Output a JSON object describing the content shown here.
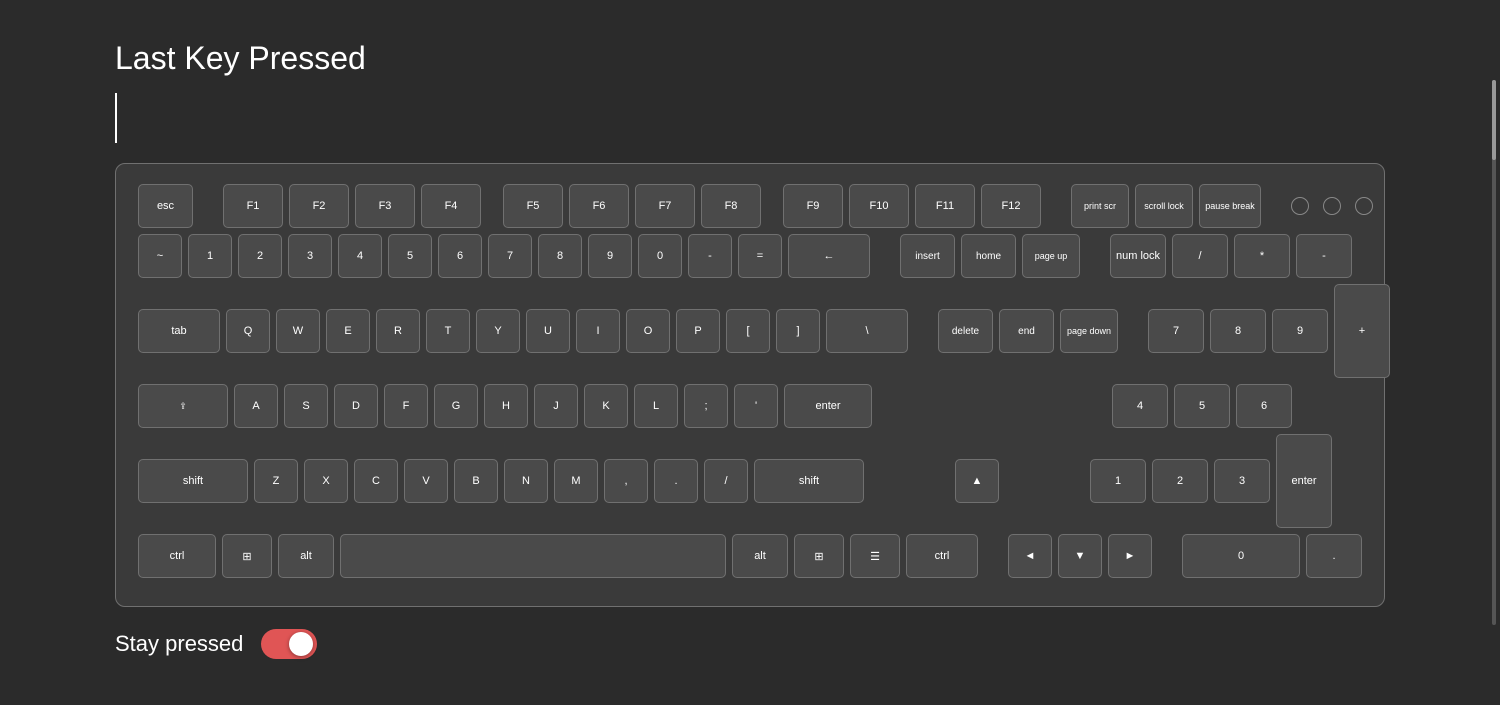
{
  "page": {
    "title": "Last Key Pressed",
    "background": "#2b2b2b"
  },
  "bottom": {
    "stay_pressed_label": "Stay pressed",
    "toggle_state": true
  },
  "keyboard": {
    "rows": {
      "fn": {
        "esc": "esc",
        "f1": "F1",
        "f2": "F2",
        "f3": "F3",
        "f4": "F4",
        "f5": "F5",
        "f6": "F6",
        "f7": "F7",
        "f8": "F8",
        "f9": "F9",
        "f10": "F10",
        "f11": "F11",
        "f12": "F12",
        "print": "print scr",
        "scroll": "scroll lock",
        "pause": "pause break"
      },
      "number": {
        "tilde": "~",
        "n1": "1",
        "n2": "2",
        "n3": "3",
        "n4": "4",
        "n5": "5",
        "n6": "6",
        "n7": "7",
        "n8": "8",
        "n9": "9",
        "n0": "0",
        "minus": "-",
        "equals": "=",
        "backspace": "←",
        "insert": "insert",
        "home": "home",
        "pgup": "page up",
        "numlock": "num lock",
        "numslash": "/",
        "numstar": "*",
        "numminus": "-"
      },
      "tab": {
        "tab": "tab",
        "q": "Q",
        "w": "W",
        "e": "E",
        "r": "R",
        "t": "T",
        "y": "Y",
        "u": "U",
        "i": "I",
        "o": "O",
        "p": "P",
        "lbracket": "[",
        "rbracket": "]",
        "backslash": "\\",
        "delete": "delete",
        "end": "end",
        "pgdn": "page down",
        "num7": "7",
        "num8": "8",
        "num9": "9"
      },
      "caps": {
        "caps": "",
        "a": "A",
        "s": "S",
        "d": "D",
        "f": "F",
        "g": "G",
        "h": "H",
        "j": "J",
        "k": "K",
        "l": "L",
        "semicolon": ";",
        "quote": "'",
        "enter": "enter",
        "num4": "4",
        "num5": "5",
        "num6": "6"
      },
      "shift": {
        "lshift": "shift",
        "z": "Z",
        "x": "X",
        "c": "C",
        "v": "V",
        "b": "B",
        "n": "N",
        "m": "M",
        "comma": ",",
        "period": ".",
        "slash": "/",
        "rshift": "shift",
        "up": "▲",
        "num1": "1",
        "num2": "2",
        "num3": "3"
      },
      "ctrl": {
        "lctrl": "ctrl",
        "lwin": "⊞",
        "lalt": "alt",
        "space": "",
        "ralt": "alt",
        "rwin": "⊞",
        "menu": "☰",
        "rctrl": "ctrl",
        "left": "◄",
        "down": "▼",
        "right": "►",
        "num0": "0",
        "numdot": "."
      }
    }
  }
}
